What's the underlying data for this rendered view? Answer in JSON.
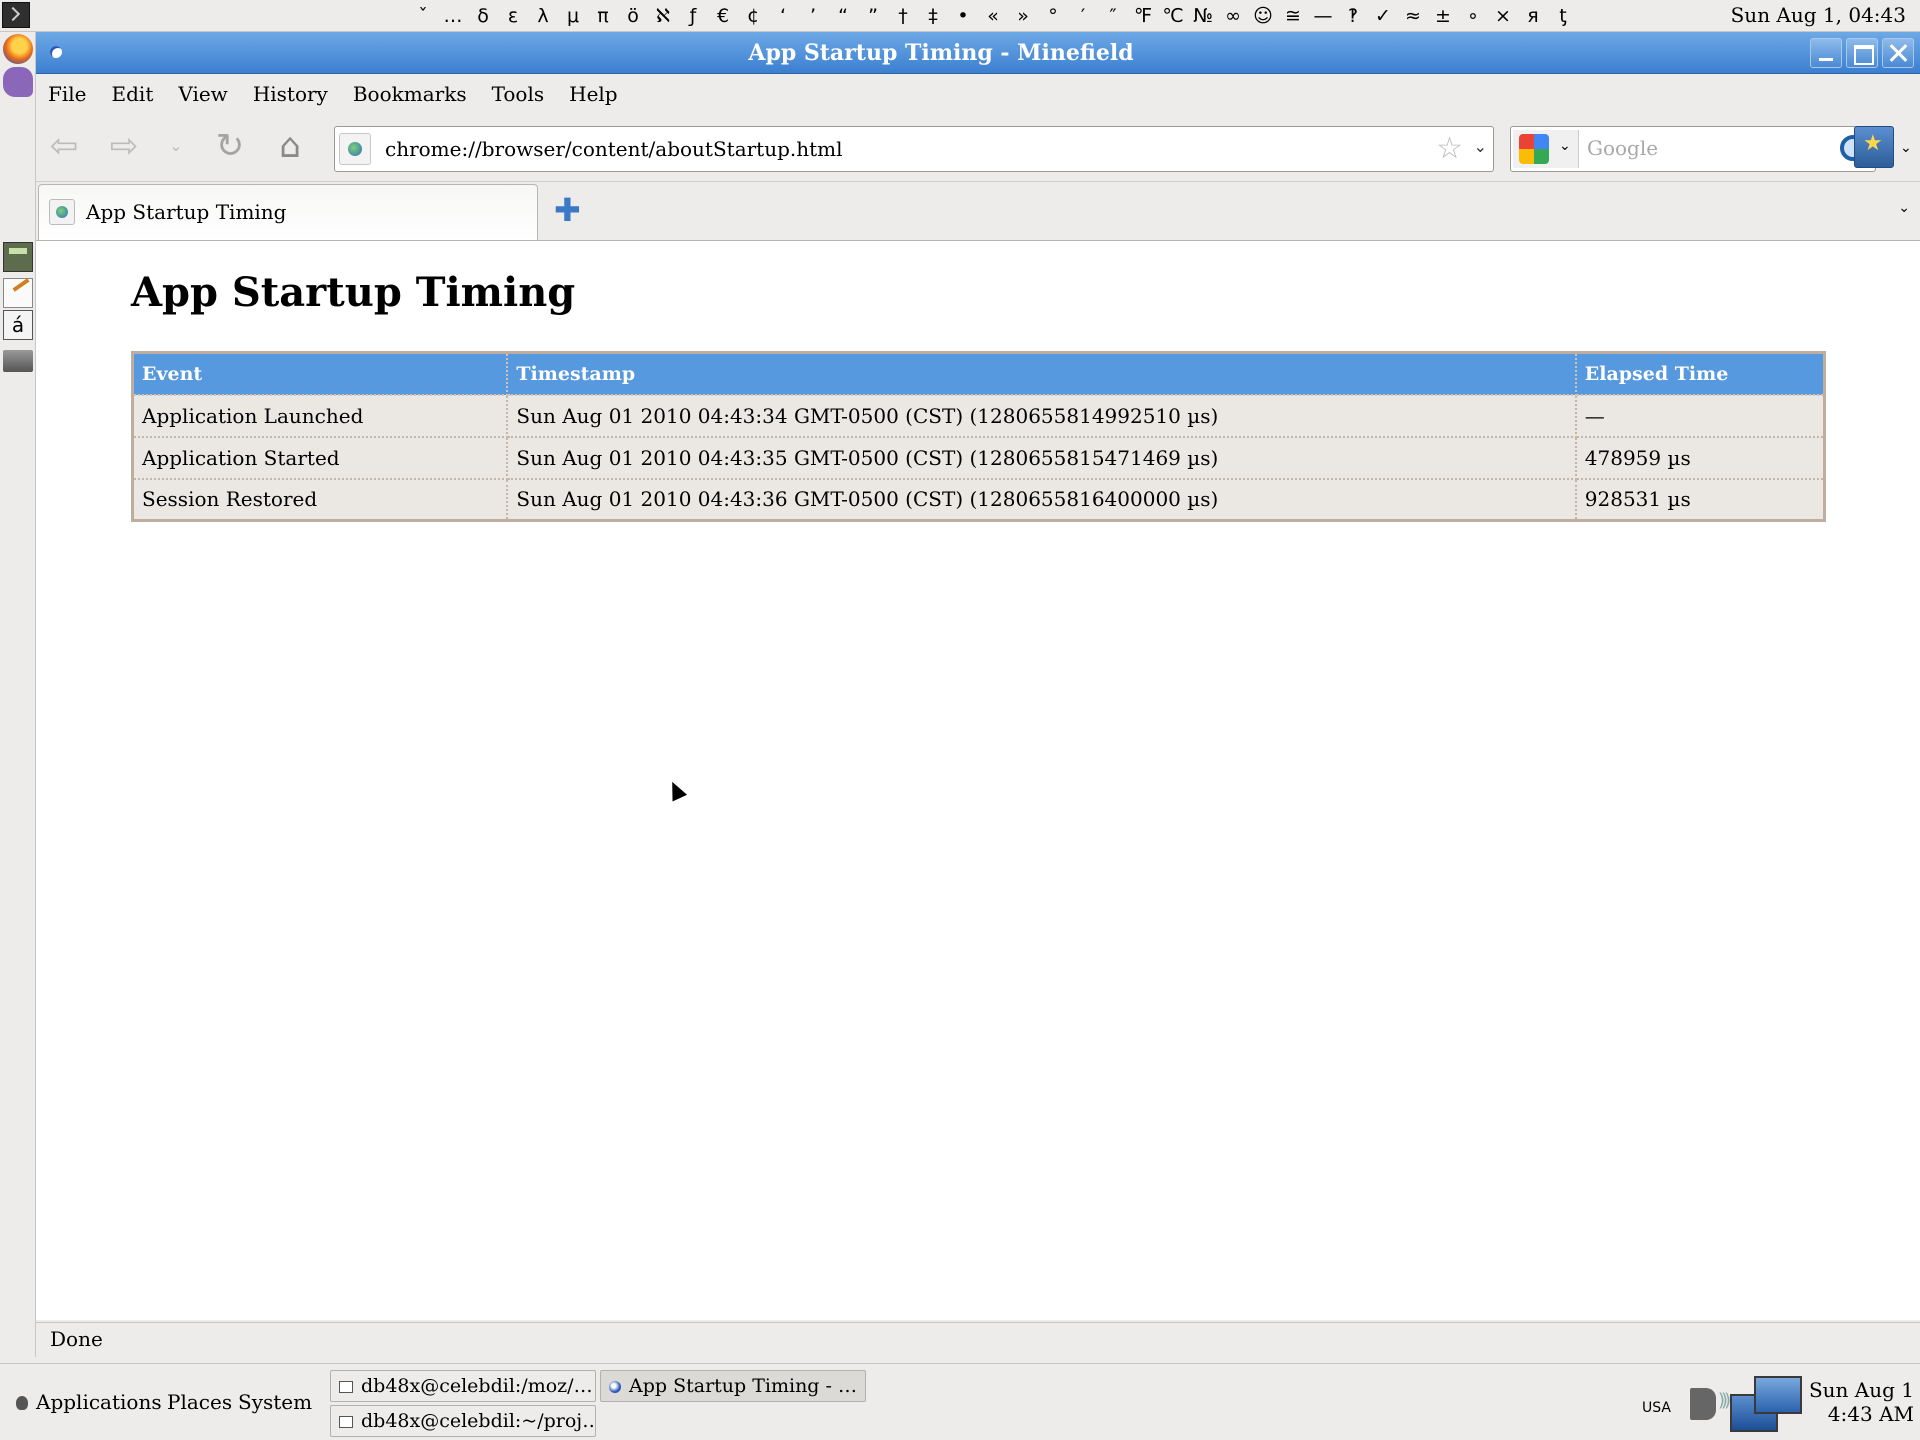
{
  "top_panel": {
    "char_picker": [
      "ˇ",
      "…",
      "δ",
      "ε",
      "λ",
      "μ",
      "π",
      "ö",
      "ℵ",
      "ƒ",
      "€",
      "¢",
      "‘",
      "’",
      "“",
      "”",
      "†",
      "‡",
      "•",
      "«",
      "»",
      "°",
      "′",
      "″",
      "℉",
      "℃",
      "№",
      "∞",
      "☺",
      "≅",
      "—",
      "‽",
      "✓",
      "≈",
      "±",
      "∘",
      "×",
      "я",
      "ƫ"
    ],
    "clock": "Sun Aug  1, 04:43"
  },
  "left_panel": {
    "char_launcher_glyph": "á"
  },
  "window": {
    "title": "App Startup Timing - Minefield"
  },
  "menubar": {
    "items": [
      "File",
      "Edit",
      "View",
      "History",
      "Bookmarks",
      "Tools",
      "Help"
    ]
  },
  "navbar": {
    "back_glyph": "⇦",
    "forward_glyph": "⇨",
    "dropdown_glyph": "⌄",
    "reload_glyph": "↻",
    "home_glyph": "⌂",
    "url": "chrome://browser/content/aboutStartup.html",
    "star_glyph": "☆",
    "url_dropdown_glyph": "⌄",
    "search_placeholder": "Google",
    "search_engine_dropdown_glyph": "⌄",
    "bookmarks_dropdown_glyph": "⌄"
  },
  "tabbar": {
    "tabs": [
      {
        "label": "App Startup Timing"
      }
    ],
    "new_tab_glyph": "✚",
    "tab_list_glyph": "⌄"
  },
  "page": {
    "title": "App Startup Timing",
    "table": {
      "headers": [
        "Event",
        "Timestamp",
        "Elapsed Time"
      ],
      "rows": [
        [
          "Application Launched",
          "Sun Aug 01 2010 04:43:34 GMT-0500 (CST) (1280655814992510 µs)",
          "—"
        ],
        [
          "Application Started",
          "Sun Aug 01 2010 04:43:35 GMT-0500 (CST) (1280655815471469 µs)",
          "478959 µs"
        ],
        [
          "Session Restored",
          "Sun Aug 01 2010 04:43:36 GMT-0500 (CST) (1280655816400000 µs)",
          "928531 µs"
        ]
      ]
    }
  },
  "statusbar": {
    "text": "Done"
  },
  "bottom_panel": {
    "menus": [
      "Applications",
      "Places",
      "System"
    ],
    "tasks": [
      "db48x@celebdil:/moz/…",
      "App Startup Timing - …",
      "db48x@celebdil:~/proj…"
    ],
    "keyboard_layout": "USA",
    "clock_line1": "Sun Aug  1",
    "clock_line2": "4:43 AM"
  },
  "colors": {
    "titlebar": "#3c7fd0",
    "table_header": "#5699de",
    "table_cell": "#ebe8e4"
  }
}
